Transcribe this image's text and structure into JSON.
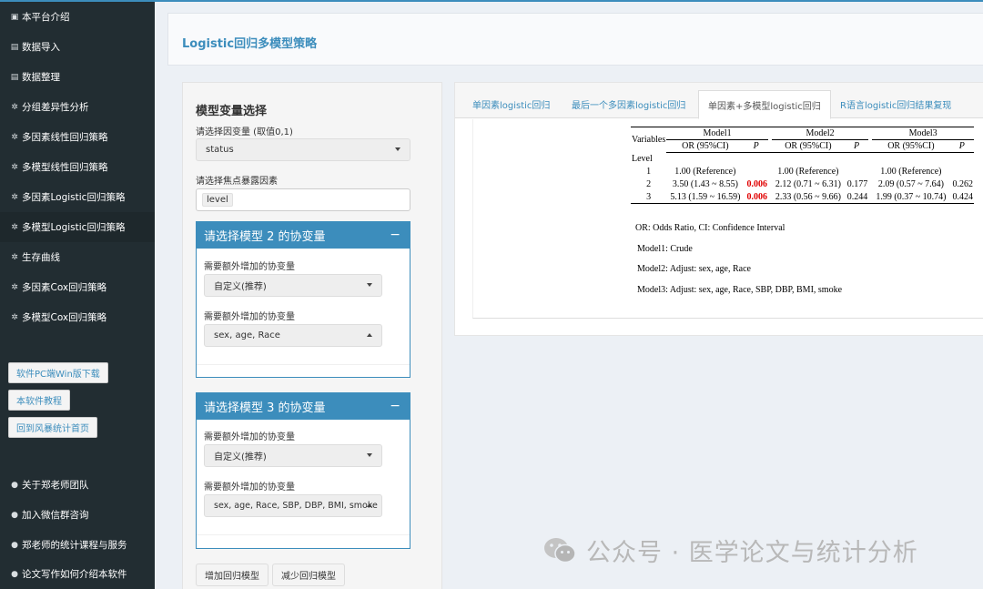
{
  "sidebar": {
    "items": [
      {
        "label": "本平台介绍",
        "icon": "info-square-icon"
      },
      {
        "label": "数据导入",
        "icon": "database-icon"
      },
      {
        "label": "数据整理",
        "icon": "database-icon"
      },
      {
        "label": "分组差异性分析",
        "icon": "gear-icon"
      },
      {
        "label": "多因素线性回归策略",
        "icon": "gear-icon"
      },
      {
        "label": "多模型线性回归策略",
        "icon": "gear-icon"
      },
      {
        "label": "多因素Logistic回归策略",
        "icon": "gear-icon"
      },
      {
        "label": "多模型Logistic回归策略",
        "icon": "gear-icon"
      },
      {
        "label": "生存曲线",
        "icon": "gear-icon"
      },
      {
        "label": "多因素Cox回归策略",
        "icon": "gear-icon"
      },
      {
        "label": "多模型Cox回归策略",
        "icon": "gear-icon"
      }
    ],
    "buttons": [
      "软件PC端Win版下载",
      "本软件教程",
      "回到风暴统计首页"
    ],
    "bottom_items": [
      "关于郑老师团队",
      "加入微信群咨询",
      "郑老师的统计课程与服务",
      "论文写作如何介绍本软件"
    ]
  },
  "header": {
    "title": "Logistic回归多模型策略"
  },
  "controls": {
    "title": "模型变量选择",
    "dependent_label": "请选择因变量 (取值0,1)",
    "dependent_value": "status",
    "exposure_label": "请选择焦点暴露因素",
    "exposure_tag": "level",
    "model2": {
      "title": "请选择模型 2 的协变量",
      "collapse": "−",
      "label1": "需要额外增加的协变量",
      "value1": "自定义(推荐)",
      "label2": "需要额外增加的协变量",
      "value2": "sex, age, Race"
    },
    "model3": {
      "title": "请选择模型 3 的协变量",
      "collapse": "−",
      "label1": "需要额外增加的协变量",
      "value1": "自定义(推荐)",
      "label2": "需要额外增加的协变量",
      "value2": "sex, age, Race, SBP, DBP, BMI, smoke"
    },
    "add_button": "增加回归模型",
    "remove_button": "减少回归模型"
  },
  "tabs": [
    {
      "label": "单因素logistic回归",
      "active": false
    },
    {
      "label": "最后一个多因素logistic回归",
      "active": false
    },
    {
      "label": "单因素+多模型logistic回归",
      "active": true
    },
    {
      "label": "R语言logistic回归结果复现",
      "active": false
    }
  ],
  "result_table": {
    "variables_header": "Variables",
    "models": [
      "Model1",
      "Model2",
      "Model3"
    ],
    "or_header": "OR (95%CI)",
    "p_header": "P",
    "group_label": "Level",
    "rows": [
      {
        "level": "1",
        "m1_or": "1.00 (Reference)",
        "m1_p": "",
        "m2_or": "1.00 (Reference)",
        "m2_p": "",
        "m3_or": "1.00 (Reference)",
        "m3_p": ""
      },
      {
        "level": "2",
        "m1_or": "3.50 (1.43 ~ 8.55)",
        "m1_p": "0.006",
        "m2_or": "2.12 (0.71 ~ 6.31)",
        "m2_p": "0.177",
        "m3_or": "2.09 (0.57 ~ 7.64)",
        "m3_p": "0.262"
      },
      {
        "level": "3",
        "m1_or": "5.13 (1.59 ~ 16.59)",
        "m1_p": "0.006",
        "m2_or": "2.33 (0.56 ~ 9.66)",
        "m2_p": "0.244",
        "m3_or": "1.99 (0.37 ~ 10.74)",
        "m3_p": "0.424"
      }
    ],
    "significant_color": "#e00000",
    "notes": [
      "OR: Odds Ratio, CI: Confidence Interval",
      "Model1: Crude",
      "Model2: Adjust: sex, age, Race",
      "Model3: Adjust: sex, age, Race, SBP, DBP, BMI, smoke"
    ]
  },
  "watermark": {
    "text": "公众号 · 医学论文与统计分析",
    "icon": "wechat-icon"
  },
  "colors": {
    "accent": "#3c8dbc",
    "sidebar": "#222d32"
  }
}
